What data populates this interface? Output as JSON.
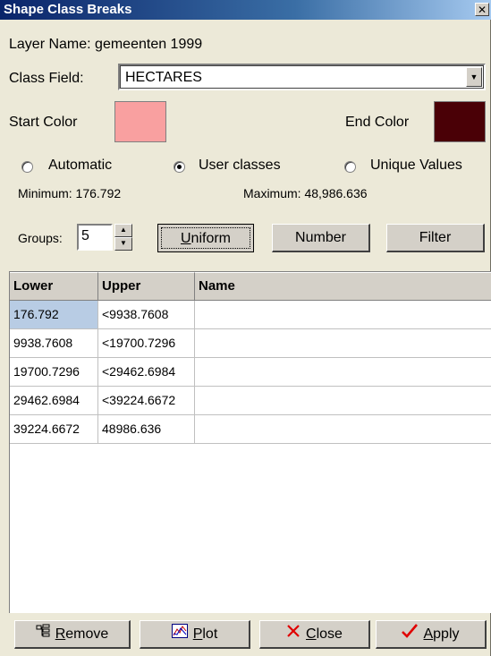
{
  "window": {
    "title": "Shape Class Breaks",
    "close_glyph": "✕"
  },
  "layer": {
    "label": "Layer Name:",
    "value": "gemeenten 1999"
  },
  "class_field": {
    "label": "Class Field:",
    "value": "HECTARES"
  },
  "colors": {
    "start_label": "Start Color",
    "start_color": "#f9a0a0",
    "end_label": "End Color",
    "end_color": "#4a0006"
  },
  "modes": {
    "automatic": "Automatic",
    "user_classes": "User classes",
    "unique_values": "Unique Values",
    "selected": "user_classes"
  },
  "range": {
    "minimum": "Minimum: 176.792",
    "maximum": "Maximum: 48,986.636"
  },
  "groups": {
    "label": "Groups:",
    "value": "5"
  },
  "buttons": {
    "uniform_first": "U",
    "uniform_rest": "niform",
    "number": "Number",
    "filter": "Filter",
    "remove_first": "R",
    "remove_rest": "emove",
    "plot_first": "P",
    "plot_rest": "lot",
    "close_first": "C",
    "close_rest": "lose",
    "apply_first": "A",
    "apply_rest": "pply"
  },
  "table": {
    "headers": [
      "Lower",
      "Upper",
      "Name"
    ],
    "rows": [
      [
        "176.792",
        "<9938.7608",
        ""
      ],
      [
        "9938.7608",
        "<19700.7296",
        ""
      ],
      [
        "19700.7296",
        "<29462.6984",
        ""
      ],
      [
        "29462.6984",
        "<39224.6672",
        ""
      ],
      [
        "39224.6672",
        "48986.636",
        ""
      ]
    ]
  }
}
